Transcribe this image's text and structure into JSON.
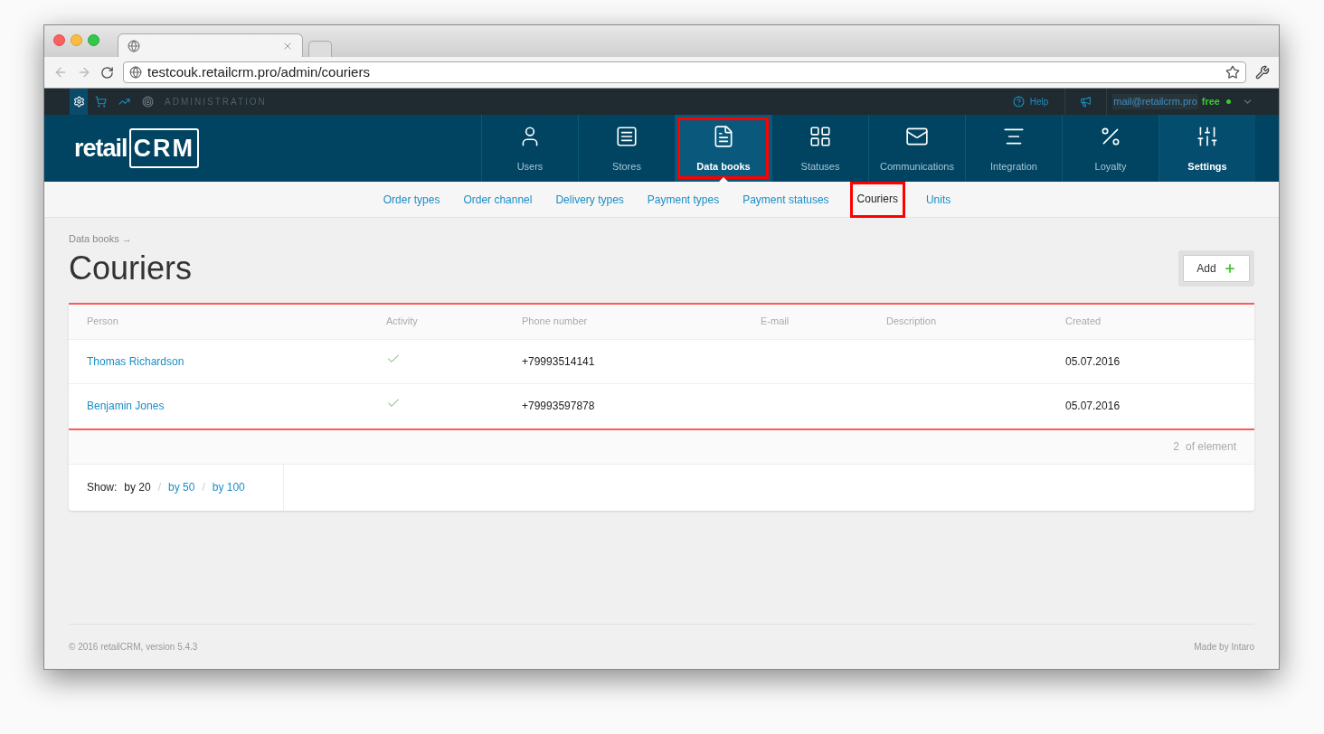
{
  "browser": {
    "url": "testcouk.retailcrm.pro/admin/couriers"
  },
  "admin_bar": {
    "label": "ADMINISTRATION",
    "help": "Help",
    "email": "mail@retailcrm.pro",
    "plan": "free"
  },
  "logo": {
    "text": "retail",
    "boxed": "CRM"
  },
  "nav": [
    {
      "label": "Users",
      "selected": false,
      "current": false,
      "highlighted": false
    },
    {
      "label": "Stores",
      "selected": false,
      "current": false,
      "highlighted": false
    },
    {
      "label": "Data books",
      "selected": true,
      "current": false,
      "highlighted": true
    },
    {
      "label": "Statuses",
      "selected": false,
      "current": false,
      "highlighted": false
    },
    {
      "label": "Communications",
      "selected": false,
      "current": false,
      "highlighted": false
    },
    {
      "label": "Integration",
      "selected": false,
      "current": false,
      "highlighted": false
    },
    {
      "label": "Loyalty",
      "selected": false,
      "current": false,
      "highlighted": false
    },
    {
      "label": "Settings",
      "selected": false,
      "current": true,
      "highlighted": false
    }
  ],
  "subnav": [
    {
      "label": "Order types",
      "selected": false,
      "highlighted": false
    },
    {
      "label": "Order channel",
      "selected": false,
      "highlighted": false
    },
    {
      "label": "Delivery types",
      "selected": false,
      "highlighted": false
    },
    {
      "label": "Payment types",
      "selected": false,
      "highlighted": false
    },
    {
      "label": "Payment statuses",
      "selected": false,
      "highlighted": false
    },
    {
      "label": "Couriers",
      "selected": true,
      "highlighted": true
    },
    {
      "label": "Units",
      "selected": false,
      "highlighted": false
    }
  ],
  "breadcrumb": "Data books →",
  "title": "Couriers",
  "add_button": "Add",
  "table": {
    "columns": [
      "Person",
      "Activity",
      "Phone number",
      "E-mail",
      "Description",
      "Created"
    ],
    "rows": [
      {
        "person": "Thomas Richardson",
        "active": true,
        "phone": "+79993514141",
        "created": "05.07.2016"
      },
      {
        "person": "Benjamin Jones",
        "active": true,
        "phone": "+79993597878",
        "created": "05.07.2016"
      }
    ]
  },
  "count": {
    "number": "2",
    "label": "of element"
  },
  "pager": {
    "label": "Show:",
    "separator": "/",
    "options": [
      {
        "label": "by 20",
        "selected": true
      },
      {
        "label": "by 50",
        "selected": false
      },
      {
        "label": "by 100",
        "selected": false
      }
    ]
  },
  "footer": {
    "copyright": "© 2016 retailCRM, version 5.4.3",
    "credit": "Made by Intaro"
  }
}
